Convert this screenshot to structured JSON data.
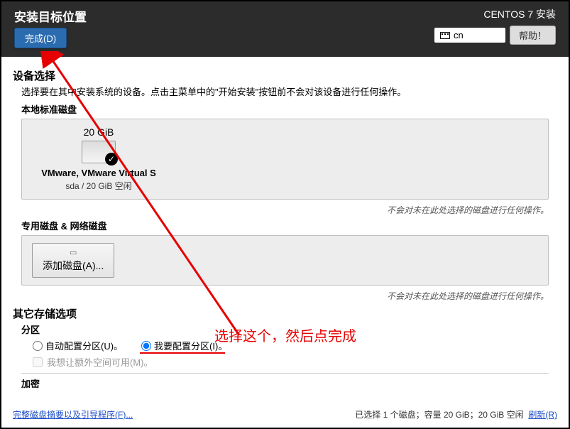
{
  "header": {
    "title": "安装目标位置",
    "done": "完成(D)",
    "install": "CENTOS 7 安装",
    "lang": "cn",
    "help": "帮助！"
  },
  "device": {
    "title": "设备选择",
    "desc": "选择要在其中安装系统的设备。点击主菜单中的\"开始安装\"按钮前不会对该设备进行任何操作。",
    "local_label": "本地标准磁盘",
    "disk": {
      "size": "20 GiB",
      "name": "VMware, VMware Virtual S",
      "info": "sda   /   20 GiB 空闲"
    },
    "note": "不会对未在此处选择的磁盘进行任何操作。",
    "special_label": "专用磁盘 & 网络磁盘",
    "add_disk": "添加磁盘(A)..."
  },
  "storage": {
    "title": "其它存储选项",
    "partition_label": "分区",
    "auto": "自动配置分区(U)。",
    "manual": "我要配置分区(I)。",
    "reclaim": "我想让额外空间可用(M)。",
    "encrypt_label": "加密"
  },
  "footer": {
    "link": "完整磁盘摘要以及引导程序(F)...",
    "status": "已选择 1 个磁盘；容量 20 GiB；20 GiB 空闲",
    "refresh": "刷新(R)"
  },
  "annotation": {
    "text": "选择这个，然后点完成"
  }
}
